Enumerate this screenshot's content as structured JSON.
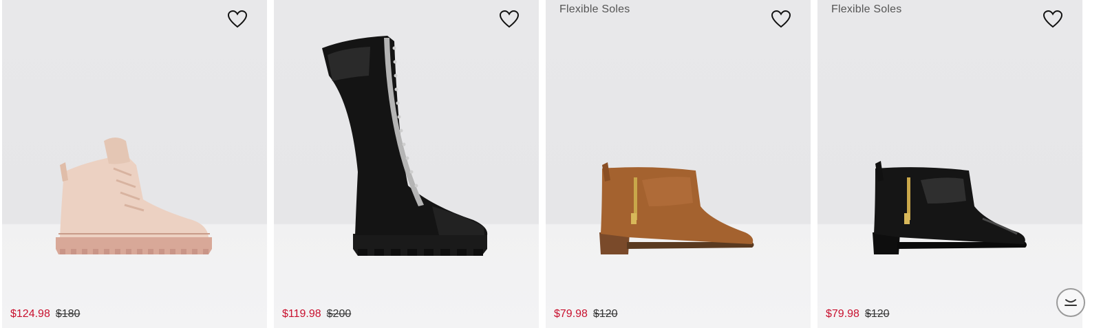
{
  "products": [
    {
      "badge": "",
      "sale_price": "$124.98",
      "original_price": "$180",
      "wishlist_icon": "heart-outline-icon"
    },
    {
      "badge": "",
      "sale_price": "$119.98",
      "original_price": "$200",
      "wishlist_icon": "heart-outline-icon"
    },
    {
      "badge": "Flexible Soles",
      "sale_price": "$79.98",
      "original_price": "$120",
      "wishlist_icon": "heart-outline-icon"
    },
    {
      "badge": "Flexible Soles",
      "sale_price": "$79.98",
      "original_price": "$120",
      "wishlist_icon": "heart-outline-icon"
    }
  ],
  "chat_widget": {
    "icon": "chat-smile-icon"
  },
  "colors": {
    "sale": "#c8102e",
    "original": "#333333",
    "tile_bg": "#e8e8ea"
  }
}
